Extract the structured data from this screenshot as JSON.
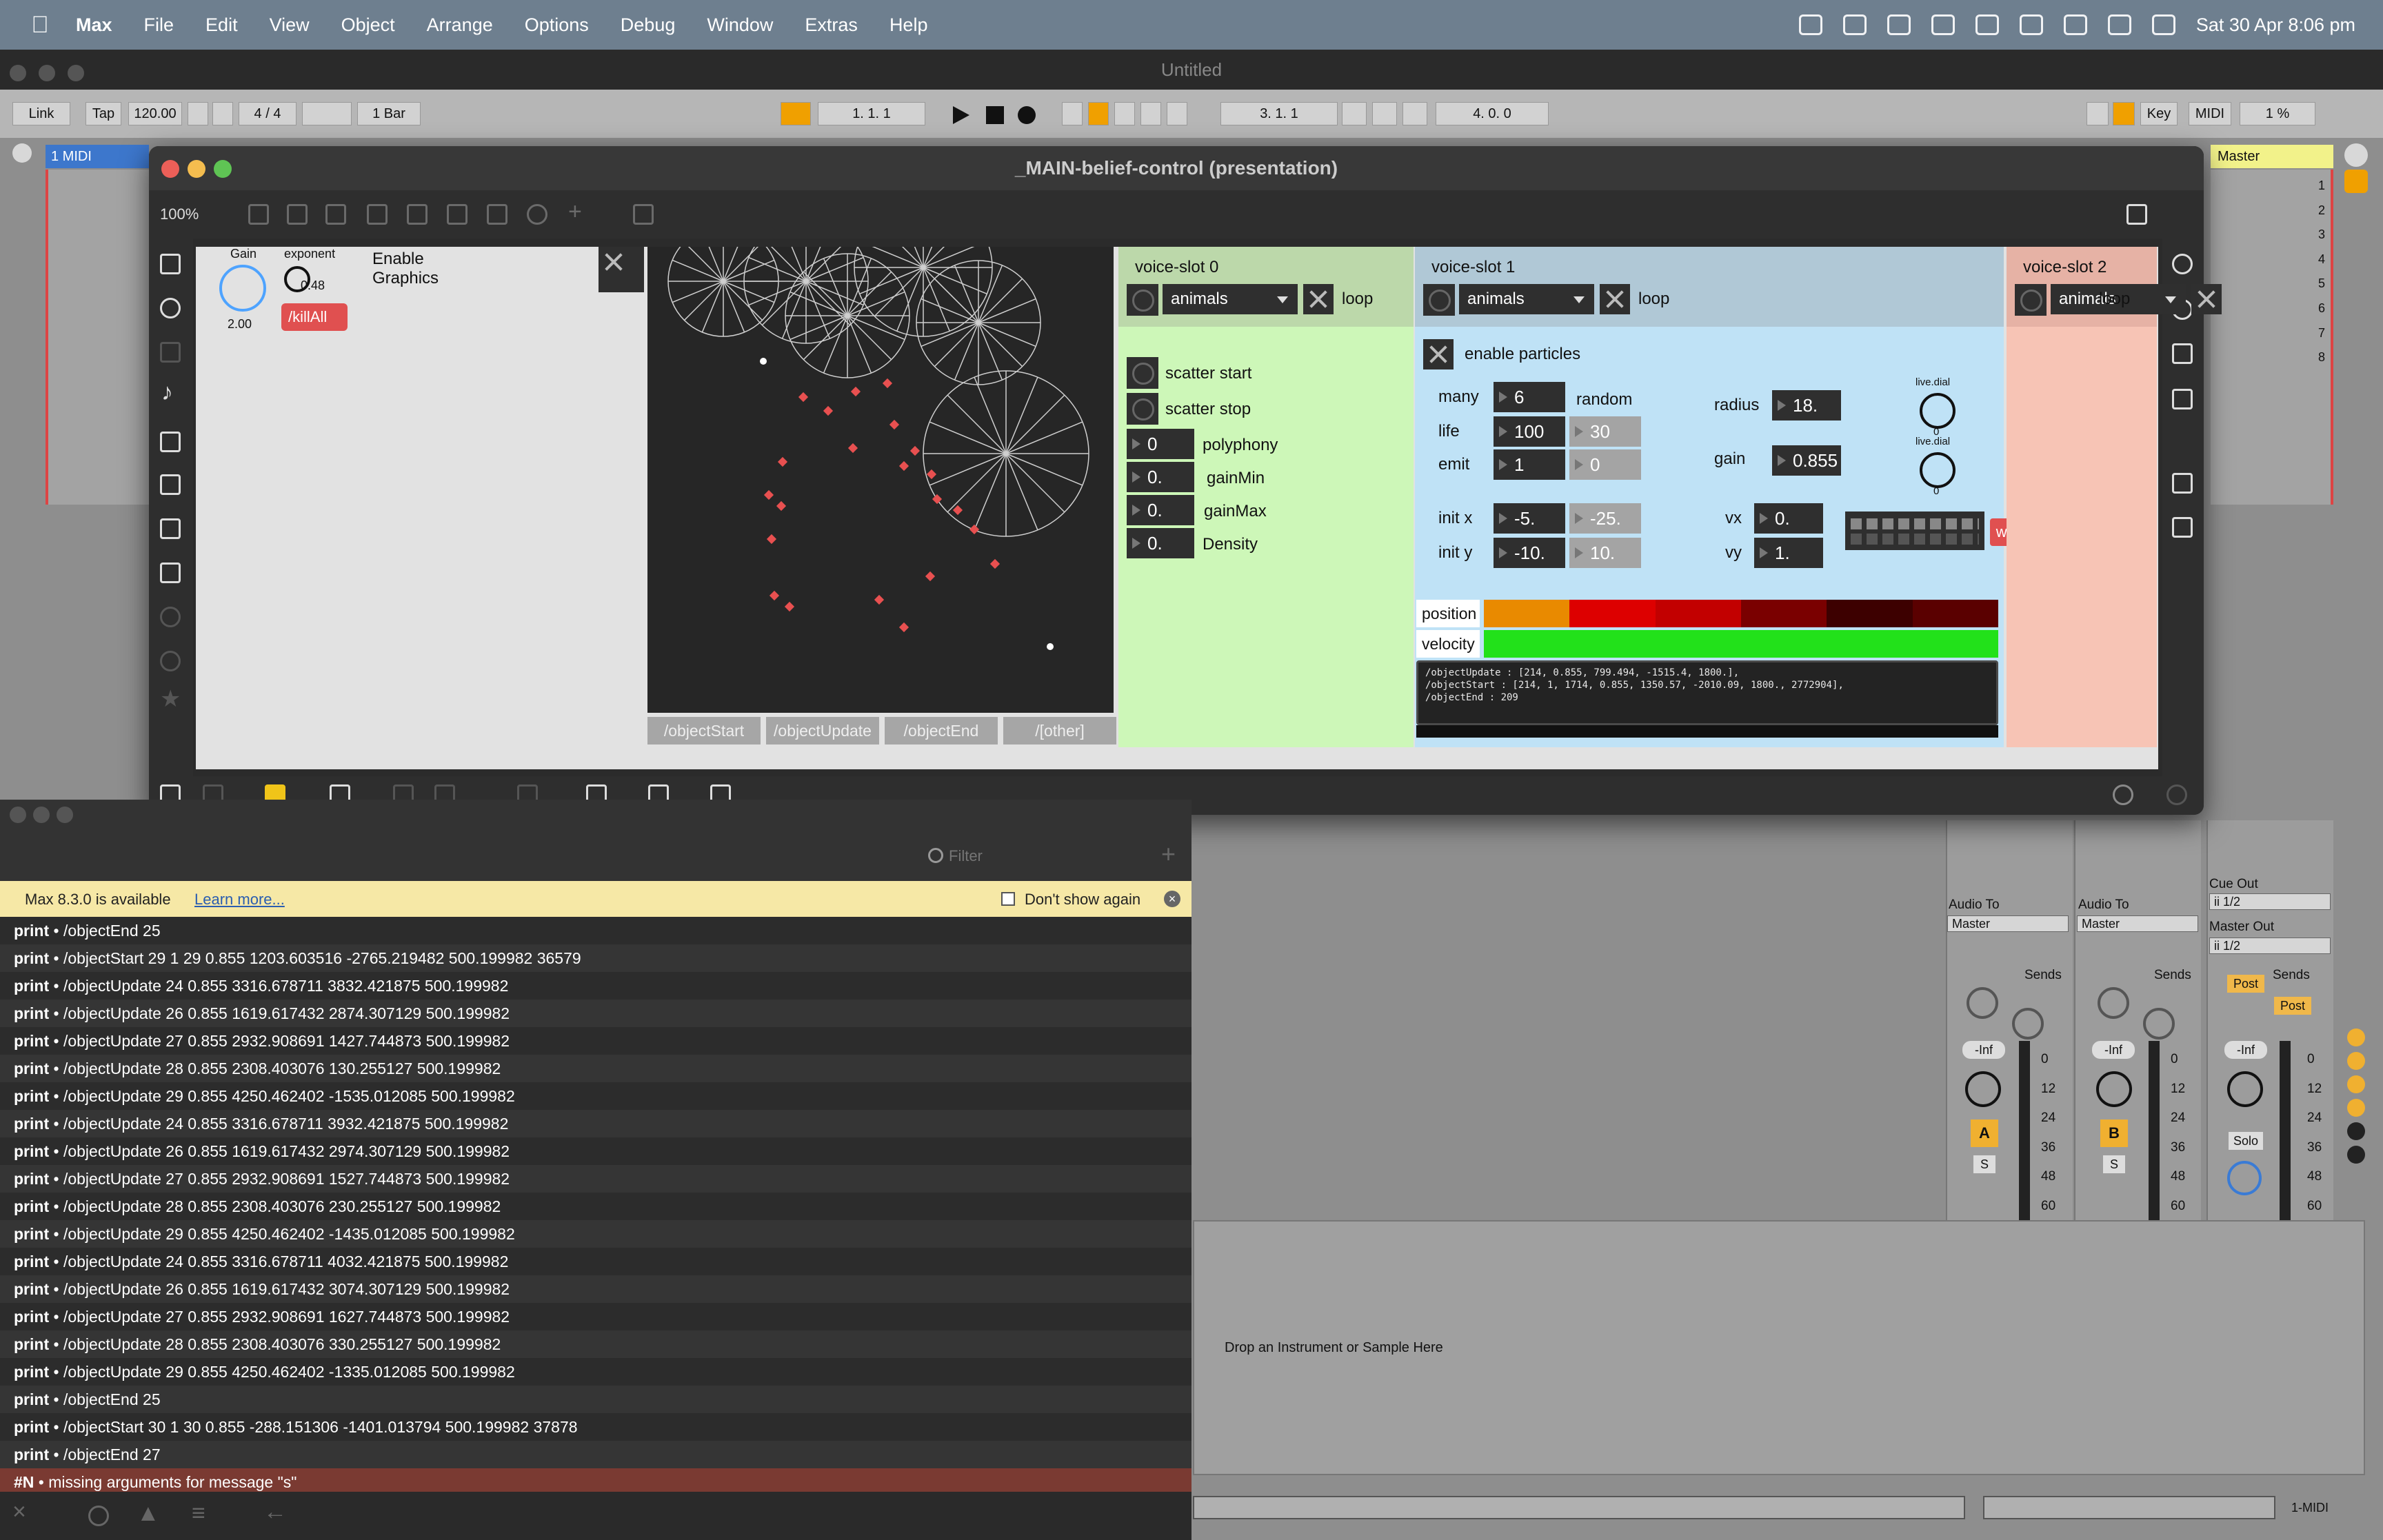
{
  "menubar": {
    "app": "Max",
    "items": [
      "File",
      "Edit",
      "View",
      "Object",
      "Arrange",
      "Options",
      "Debug",
      "Window",
      "Extras",
      "Help"
    ],
    "datetime": "Sat 30 Apr  8:06 pm"
  },
  "live": {
    "title": "Untitled",
    "link": "Link",
    "tap": "Tap",
    "tempo": "120.00",
    "signature": "4 / 4",
    "quantize": "1 Bar",
    "position": "1.   1.   1",
    "loop_start": "3.   1.   1",
    "loop_len": "4.   0.   0",
    "key": "Key",
    "midi": "MIDI",
    "cpu": "1 %",
    "track_name": "1 MIDI",
    "master_name": "Master",
    "scene_numbers": [
      "1",
      "2",
      "3",
      "4",
      "5",
      "6",
      "7",
      "8"
    ],
    "audio_to_label": "Audio To",
    "audio_to_value": "Master",
    "cue_out_label": "Cue Out",
    "cue_out_value": "ii 1/2",
    "master_out_label": "Master Out",
    "master_out_value": "ii 1/2",
    "sends": "Sends",
    "post": "Post",
    "inf": "-Inf",
    "meter_ticks": [
      "0",
      "12",
      "24",
      "36",
      "48",
      "60"
    ],
    "track_a": "A",
    "track_b": "B",
    "solo_s": "S",
    "solo": "Solo",
    "drop_text": "Drop an Instrument or Sample Here",
    "bottom_track": "1-MIDI"
  },
  "patcher": {
    "title": "_MAIN-belief-control (presentation)",
    "zoom": "100%",
    "gain_label": "Gain",
    "gain_value": "2.00",
    "exponent_label": "exponent",
    "exponent_value": "0.48",
    "killall": "/killAll",
    "enable_graphics": "Enable\nGraphics",
    "route_buttons": [
      "/objectStart",
      "/objectUpdate",
      "/objectEnd",
      "/[other]"
    ],
    "slot0": {
      "title": "voice-slot 0",
      "menu": "animals",
      "loop": "loop",
      "scatter_start": "scatter start",
      "scatter_stop": "scatter stop",
      "rows": [
        {
          "value": "0",
          "label": "polyphony"
        },
        {
          "value": "0.",
          "label": "gainMin"
        },
        {
          "value": "0.",
          "label": "gainMax"
        },
        {
          "value": "0.",
          "label": "Density"
        }
      ]
    },
    "slot1": {
      "title": "voice-slot 1",
      "menu": "animals",
      "loop": "loop",
      "enable_particles": "enable particles",
      "many_label": "many",
      "many_value": "6",
      "random_label": "random",
      "life_label": "life",
      "life_value": "100",
      "life_rand": "30",
      "emit_label": "emit",
      "emit_value": "1",
      "emit_rand": "0",
      "radius_label": "radius",
      "radius_value": "18.",
      "gain_label": "gain",
      "gain_value": "0.855",
      "live_dial": "live.dial",
      "live_dial_value": "0",
      "initx_label": "init x",
      "initx_value": "-5.",
      "initx_rand": "-25.",
      "inity_label": "init y",
      "inity_value": "-10.",
      "inity_rand": "10.",
      "vx_label": "vx",
      "vx_value": "0.",
      "vy_label": "vy",
      "vy_value": "1.",
      "write": "write",
      "position": "position",
      "velocity": "velocity",
      "message_lines": [
        "/objectUpdate : [214, 0.855, 799.494, -1515.4, 1800.],",
        "/objectStart : [214, 1, 1714, 0.855, 1350.57, -2010.09, 1800., 2772904],",
        "/objectEnd : 209"
      ]
    },
    "slot2": {
      "title": "voice-slot 2",
      "menu": "animals",
      "loop": "loop"
    }
  },
  "console": {
    "filter_placeholder": "Filter",
    "update_text": "Max 8.3.0 is available",
    "learn_more": "Learn more...",
    "dont_show": "Don't show again",
    "rows": [
      {
        "src": "print",
        "msg": "/objectEnd 25"
      },
      {
        "src": "print",
        "msg": "/objectStart 29 1 29 0.855 1203.603516 -2765.219482 500.199982 36579"
      },
      {
        "src": "print",
        "msg": "/objectUpdate 24 0.855 3316.678711 3832.421875 500.199982"
      },
      {
        "src": "print",
        "msg": "/objectUpdate 26 0.855 1619.617432 2874.307129 500.199982"
      },
      {
        "src": "print",
        "msg": "/objectUpdate 27 0.855 2932.908691 1427.744873 500.199982"
      },
      {
        "src": "print",
        "msg": "/objectUpdate 28 0.855 2308.403076 130.255127 500.199982"
      },
      {
        "src": "print",
        "msg": "/objectUpdate 29 0.855 4250.462402 -1535.012085 500.199982"
      },
      {
        "src": "print",
        "msg": "/objectUpdate 24 0.855 3316.678711 3932.421875 500.199982"
      },
      {
        "src": "print",
        "msg": "/objectUpdate 26 0.855 1619.617432 2974.307129 500.199982"
      },
      {
        "src": "print",
        "msg": "/objectUpdate 27 0.855 2932.908691 1527.744873 500.199982"
      },
      {
        "src": "print",
        "msg": "/objectUpdate 28 0.855 2308.403076 230.255127 500.199982"
      },
      {
        "src": "print",
        "msg": "/objectUpdate 29 0.855 4250.462402 -1435.012085 500.199982"
      },
      {
        "src": "print",
        "msg": "/objectUpdate 24 0.855 3316.678711 4032.421875 500.199982"
      },
      {
        "src": "print",
        "msg": "/objectUpdate 26 0.855 1619.617432 3074.307129 500.199982"
      },
      {
        "src": "print",
        "msg": "/objectUpdate 27 0.855 2932.908691 1627.744873 500.199982"
      },
      {
        "src": "print",
        "msg": "/objectUpdate 28 0.855 2308.403076 330.255127 500.199982"
      },
      {
        "src": "print",
        "msg": "/objectUpdate 29 0.855 4250.462402 -1335.012085 500.199982"
      },
      {
        "src": "print",
        "msg": "/objectEnd 25"
      },
      {
        "src": "print",
        "msg": "/objectStart 30 1 30 0.855 -288.151306 -1401.013794 500.199982 37878"
      },
      {
        "src": "print",
        "msg": "/objectEnd 27"
      }
    ],
    "error_src": "#N",
    "error_msg": "missing arguments for message \"s\""
  },
  "colors": {
    "slot0_bg": "#cdf7b8",
    "slot1_bg": "#bfe2f6",
    "slot2_bg": "#f7c4b5",
    "kill": "#e05050",
    "velocity": "#22e11a"
  },
  "position_bar_colors": [
    "#e98a00",
    "#dd0000",
    "#c20000",
    "#7a0000",
    "#3d0000",
    "#5a0000"
  ]
}
